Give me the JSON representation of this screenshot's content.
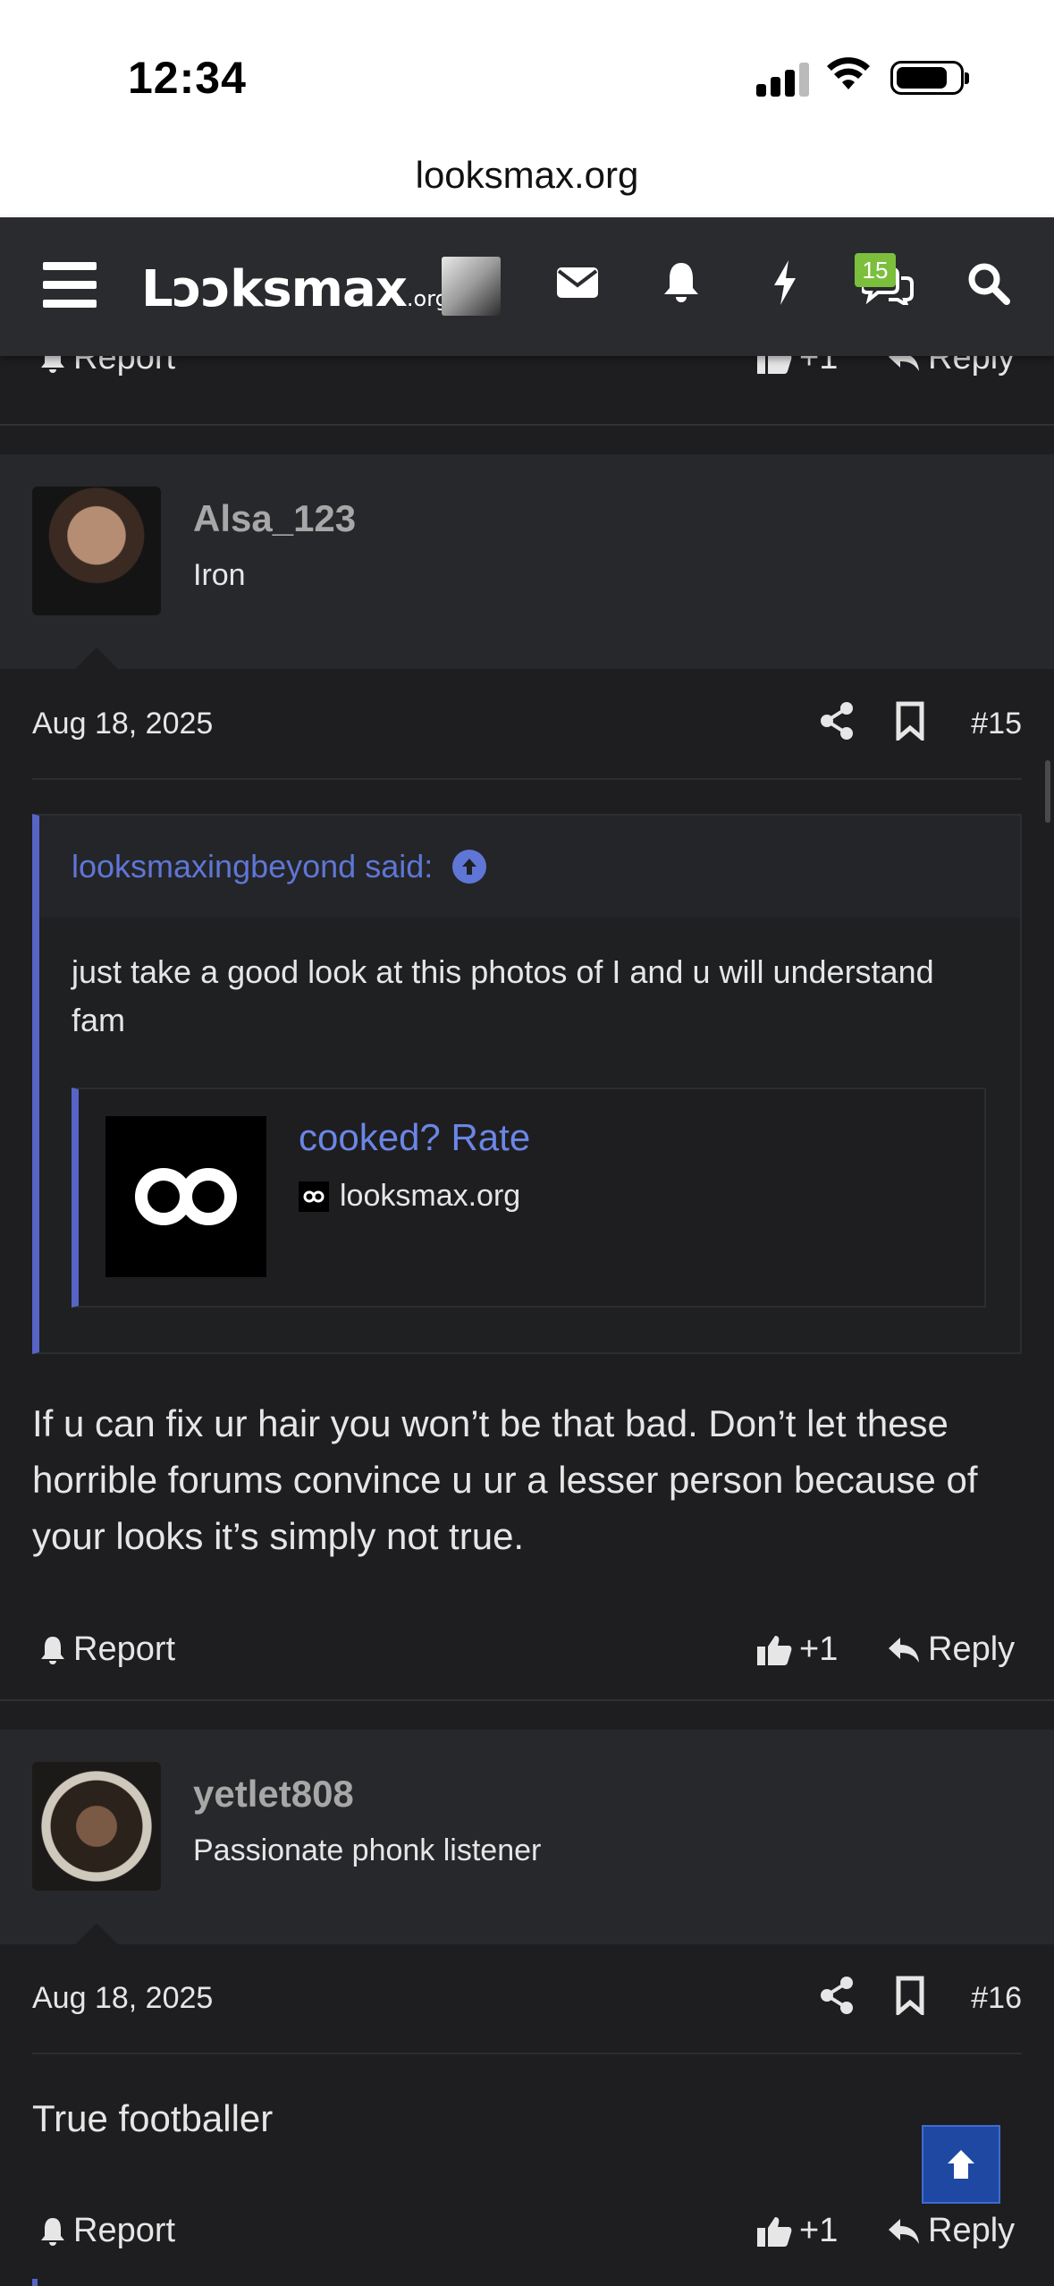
{
  "status_bar": {
    "time": "12:34"
  },
  "browser": {
    "url": "looksmax.org"
  },
  "nav": {
    "logo_main": "Lɔɔksmax",
    "logo_suffix": ".org",
    "badge_count": "15",
    "icons": [
      "menu-icon",
      "avatar",
      "mail-icon",
      "bell-icon",
      "bolt-icon",
      "chat-icon",
      "search-icon"
    ]
  },
  "prev_post_footer": {
    "report": "Report",
    "like": "+1",
    "reply": "Reply"
  },
  "posts": [
    {
      "username": "Alsa_123",
      "user_title": "Iron",
      "date": "Aug 18, 2025",
      "number": "#15",
      "quote": {
        "author": "looksmaxingbeyond said:",
        "text": "just take a good look at this photos of I and u will understand fam",
        "embed_title": "cooked? Rate",
        "embed_site": "looksmax.org"
      },
      "body": "If u can fix ur hair you won’t be that bad. Don’t let these horrible forums convince u ur a lesser person because of your looks it’s simply not true.",
      "report": "Report",
      "like": "+1",
      "reply": "Reply"
    },
    {
      "username": "yetlet808",
      "user_title": "Passionate phonk listener",
      "date": "Aug 18, 2025",
      "number": "#16",
      "body": "True footballer",
      "report": "Report",
      "like": "+1",
      "reply": "Reply"
    }
  ],
  "colors": {
    "accent": "#5764c6",
    "link": "#6b86e5",
    "badge": "#7bbf3d",
    "scroll_top": "#1f48a3"
  }
}
